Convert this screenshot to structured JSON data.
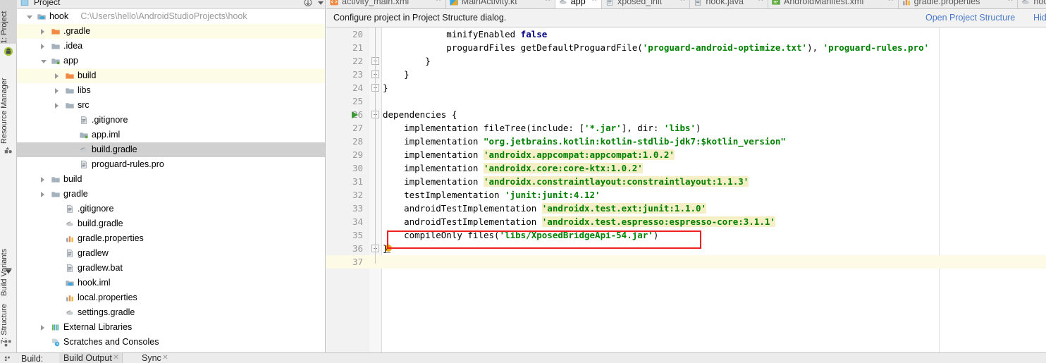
{
  "toolstrip": {
    "items": [
      {
        "label": "1: Project",
        "icon": "project-icon",
        "selected": true
      },
      {
        "label": "Resource Manager",
        "icon": "resource-manager-icon",
        "selected": false
      },
      {
        "label": "Build Variants",
        "icon": "build-variants-icon",
        "selected": false
      },
      {
        "label": "7: Structure",
        "icon": "structure-icon",
        "selected": false
      }
    ]
  },
  "project_panel": {
    "title": "Project",
    "tree": [
      {
        "label": "hook",
        "path": "C:\\Users\\hello\\AndroidStudioProjects\\hook",
        "indent": 0,
        "arrow": "open",
        "icon": "module-icon",
        "row": "plain"
      },
      {
        "label": ".gradle",
        "path": "",
        "indent": 1,
        "arrow": "closed",
        "icon": "folder-orange-icon",
        "row": "alt"
      },
      {
        "label": ".idea",
        "path": "",
        "indent": 1,
        "arrow": "closed",
        "icon": "folder-icon",
        "row": "plain"
      },
      {
        "label": "app",
        "path": "",
        "indent": 1,
        "arrow": "open",
        "icon": "module-src-icon",
        "row": "plain"
      },
      {
        "label": "build",
        "path": "",
        "indent": 2,
        "arrow": "closed",
        "icon": "folder-orange-icon",
        "row": "alt"
      },
      {
        "label": "libs",
        "path": "",
        "indent": 2,
        "arrow": "closed",
        "icon": "folder-icon",
        "row": "plain"
      },
      {
        "label": "src",
        "path": "",
        "indent": 2,
        "arrow": "closed",
        "icon": "folder-icon",
        "row": "plain"
      },
      {
        "label": ".gitignore",
        "path": "",
        "indent": 3,
        "arrow": "none",
        "icon": "file-icon",
        "row": "plain"
      },
      {
        "label": "app.iml",
        "path": "",
        "indent": 3,
        "arrow": "none",
        "icon": "module-src-icon",
        "row": "plain"
      },
      {
        "label": "build.gradle",
        "path": "",
        "indent": 3,
        "arrow": "none",
        "icon": "gradle-icon",
        "row": "sel"
      },
      {
        "label": "proguard-rules.pro",
        "path": "",
        "indent": 3,
        "arrow": "none",
        "icon": "file-icon",
        "row": "plain"
      },
      {
        "label": "build",
        "path": "",
        "indent": 1,
        "arrow": "closed",
        "icon": "folder-icon",
        "row": "plain"
      },
      {
        "label": "gradle",
        "path": "",
        "indent": 1,
        "arrow": "closed",
        "icon": "folder-icon",
        "row": "plain"
      },
      {
        "label": ".gitignore",
        "path": "",
        "indent": 2,
        "arrow": "none",
        "icon": "file-icon",
        "row": "plain"
      },
      {
        "label": "build.gradle",
        "path": "",
        "indent": 2,
        "arrow": "none",
        "icon": "gradle-icon",
        "row": "plain"
      },
      {
        "label": "gradle.properties",
        "path": "",
        "indent": 2,
        "arrow": "none",
        "icon": "properties-icon",
        "row": "plain"
      },
      {
        "label": "gradlew",
        "path": "",
        "indent": 2,
        "arrow": "none",
        "icon": "file-icon",
        "row": "plain"
      },
      {
        "label": "gradlew.bat",
        "path": "",
        "indent": 2,
        "arrow": "none",
        "icon": "file-icon",
        "row": "plain"
      },
      {
        "label": "hook.iml",
        "path": "",
        "indent": 2,
        "arrow": "none",
        "icon": "module-icon",
        "row": "plain"
      },
      {
        "label": "local.properties",
        "path": "",
        "indent": 2,
        "arrow": "none",
        "icon": "properties-icon",
        "row": "plain"
      },
      {
        "label": "settings.gradle",
        "path": "",
        "indent": 2,
        "arrow": "none",
        "icon": "gradle-icon",
        "row": "plain"
      },
      {
        "label": "External Libraries",
        "path": "",
        "indent": 1,
        "arrow": "closed",
        "icon": "libraries-icon",
        "row": "plain"
      },
      {
        "label": "Scratches and Consoles",
        "path": "",
        "indent": 1,
        "arrow": "none",
        "icon": "scratches-icon",
        "row": "plain"
      }
    ]
  },
  "editor": {
    "tabs": [
      {
        "label": "activity_main.xml",
        "icon": "xml-layout-icon",
        "active": false
      },
      {
        "label": "MainActivity.kt",
        "icon": "kotlin-icon",
        "active": false
      },
      {
        "label": "app",
        "icon": "gradle-icon",
        "active": true
      },
      {
        "label": "xposed_init",
        "icon": "text-file-icon",
        "active": false
      },
      {
        "label": "hook.java",
        "icon": "java-icon",
        "active": false
      },
      {
        "label": "AndroidManifest.xml",
        "icon": "manifest-icon",
        "active": false
      },
      {
        "label": "gradle.properties",
        "icon": "properties-icon",
        "active": false
      },
      {
        "label": "hook",
        "icon": "gradle-icon",
        "active": false
      }
    ],
    "notification": {
      "message": "Configure project in Project Structure dialog.",
      "link_primary": "Open Project Structure",
      "link_secondary": "Hid"
    },
    "annotation": {
      "color": "#ef2020",
      "target_line": 35
    },
    "lines": [
      {
        "num": "20",
        "indent": 0,
        "fold": false,
        "run": false,
        "caret": false,
        "tokens": [
          {
            "t": "            minifyEnabled ",
            "c": "plain"
          },
          {
            "t": "false",
            "c": "kw"
          }
        ]
      },
      {
        "num": "21",
        "indent": 0,
        "fold": false,
        "run": false,
        "caret": false,
        "tokens": [
          {
            "t": "            proguardFiles getDefaultProguardFile(",
            "c": "plain"
          },
          {
            "t": "'proguard-android-optimize.txt'",
            "c": "str"
          },
          {
            "t": "), ",
            "c": "plain"
          },
          {
            "t": "'proguard-rules.pro'",
            "c": "str"
          }
        ]
      },
      {
        "num": "22",
        "indent": 0,
        "fold": true,
        "run": false,
        "caret": false,
        "tokens": [
          {
            "t": "        }",
            "c": "plain"
          }
        ]
      },
      {
        "num": "23",
        "indent": 0,
        "fold": true,
        "run": false,
        "caret": false,
        "tokens": [
          {
            "t": "    }",
            "c": "plain"
          }
        ]
      },
      {
        "num": "24",
        "indent": 0,
        "fold": true,
        "run": false,
        "caret": false,
        "tokens": [
          {
            "t": "}",
            "c": "plain"
          }
        ]
      },
      {
        "num": "25",
        "indent": 0,
        "fold": false,
        "run": false,
        "caret": false,
        "tokens": [
          {
            "t": "",
            "c": "plain"
          }
        ]
      },
      {
        "num": "26",
        "indent": 0,
        "fold": true,
        "run": true,
        "caret": false,
        "tokens": [
          {
            "t": "dependencies {",
            "c": "plain"
          }
        ]
      },
      {
        "num": "27",
        "indent": 0,
        "fold": false,
        "run": false,
        "caret": false,
        "tokens": [
          {
            "t": "    implementation fileTree(include: [",
            "c": "plain"
          },
          {
            "t": "'*.jar'",
            "c": "str"
          },
          {
            "t": "], dir: ",
            "c": "plain"
          },
          {
            "t": "'libs'",
            "c": "str"
          },
          {
            "t": ")",
            "c": "plain"
          }
        ]
      },
      {
        "num": "28",
        "indent": 0,
        "fold": false,
        "run": false,
        "caret": false,
        "tokens": [
          {
            "t": "    implementation ",
            "c": "plain"
          },
          {
            "t": "\"org.jetbrains.kotlin:kotlin-stdlib-jdk7:$kotlin_version\"",
            "c": "str"
          }
        ]
      },
      {
        "num": "29",
        "indent": 0,
        "fold": false,
        "run": false,
        "caret": false,
        "tokens": [
          {
            "t": "    implementation ",
            "c": "plain"
          },
          {
            "t": "'androidx.appcompat:appcompat:1.0.2'",
            "c": "str-hl"
          }
        ]
      },
      {
        "num": "30",
        "indent": 0,
        "fold": false,
        "run": false,
        "caret": false,
        "tokens": [
          {
            "t": "    implementation ",
            "c": "plain"
          },
          {
            "t": "'androidx.core:core-ktx:1.0.2'",
            "c": "str-hl"
          }
        ]
      },
      {
        "num": "31",
        "indent": 0,
        "fold": false,
        "run": false,
        "caret": false,
        "tokens": [
          {
            "t": "    implementation ",
            "c": "plain"
          },
          {
            "t": "'androidx.constraintlayout:constraintlayout:1.1.3'",
            "c": "str-hl"
          }
        ]
      },
      {
        "num": "32",
        "indent": 0,
        "fold": false,
        "run": false,
        "caret": false,
        "tokens": [
          {
            "t": "    testImplementation ",
            "c": "plain"
          },
          {
            "t": "'junit:junit:4.12'",
            "c": "str"
          }
        ]
      },
      {
        "num": "33",
        "indent": 0,
        "fold": false,
        "run": false,
        "caret": false,
        "tokens": [
          {
            "t": "    androidTestImplementation ",
            "c": "plain"
          },
          {
            "t": "'androidx.test.ext:junit:1.1.0'",
            "c": "str-hl"
          }
        ]
      },
      {
        "num": "34",
        "indent": 0,
        "fold": false,
        "run": false,
        "caret": false,
        "tokens": [
          {
            "t": "    androidTestImplementation ",
            "c": "plain"
          },
          {
            "t": "'androidx.test.espresso:espresso-core:3.1.1'",
            "c": "str-hl"
          }
        ]
      },
      {
        "num": "35",
        "indent": 0,
        "fold": false,
        "run": false,
        "caret": false,
        "tokens": [
          {
            "t": "    compileOnly files(",
            "c": "plain"
          },
          {
            "t": "'libs/XposedBridgeApi-54.jar'",
            "c": "str"
          },
          {
            "t": ")",
            "c": "plain"
          }
        ]
      },
      {
        "num": "36",
        "indent": 0,
        "fold": true,
        "run": false,
        "caret": false,
        "bulb": true,
        "tokens": [
          {
            "t": "}",
            "c": "plain"
          }
        ]
      },
      {
        "num": "37",
        "indent": 0,
        "fold": false,
        "run": false,
        "caret": true,
        "tokens": [
          {
            "t": "",
            "c": "plain"
          }
        ]
      }
    ]
  },
  "statusbar": {
    "build_label": "Build:",
    "tabs": [
      {
        "label": "Build Output"
      },
      {
        "label": "Sync"
      }
    ]
  },
  "colors": {
    "accent_link": "#4a78c8",
    "string_green": "#008000",
    "keyword_navy": "#000080",
    "highlight_yellow": "#f5efc8",
    "annotation_red": "#ef2020",
    "selection_gray": "#d0d0d0",
    "alt_row_yellow": "#fdfde7"
  }
}
